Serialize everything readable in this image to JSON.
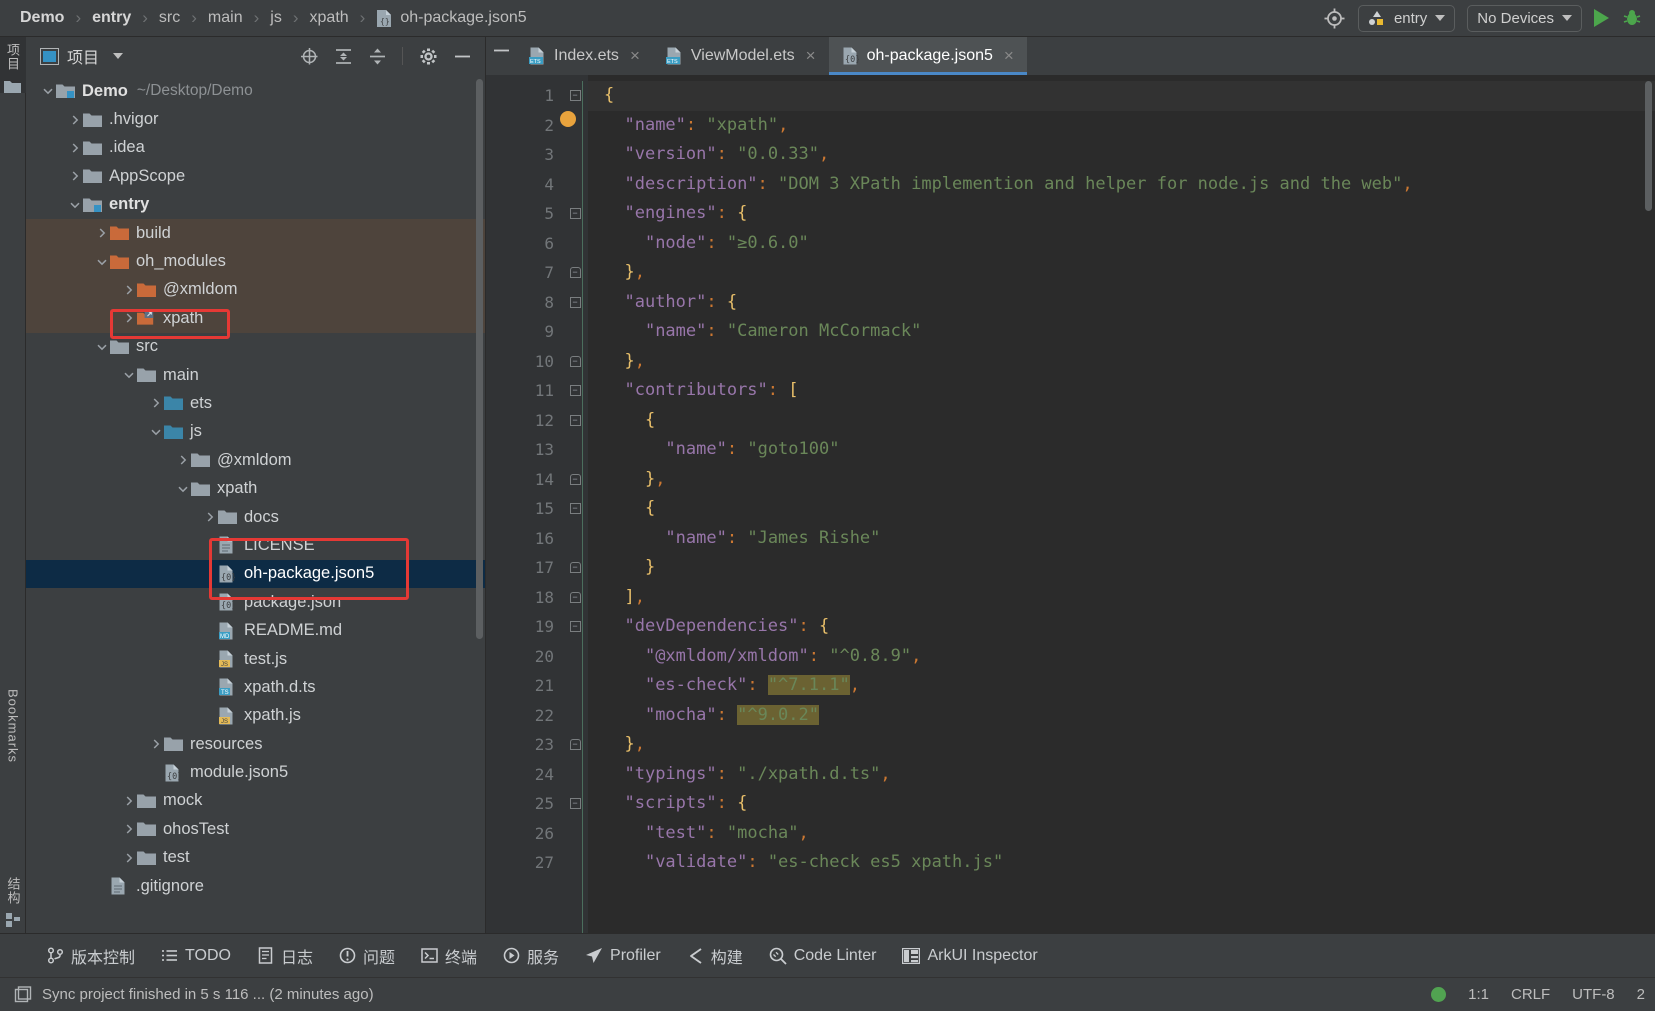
{
  "breadcrumb": {
    "items": [
      "Demo",
      "entry",
      "src",
      "main",
      "js",
      "xpath"
    ],
    "file": "oh-package.json5",
    "separator": "›"
  },
  "toolbar": {
    "target_icon": "target-icon",
    "run_config_label": "entry",
    "device_label": "No Devices",
    "run_label": "run-button",
    "debug_label": "debug-button"
  },
  "left_rail": {
    "project_label": "项目",
    "bookmarks_label": "Bookmarks",
    "structure_label": "结构"
  },
  "project_panel": {
    "title": "项目",
    "icons": [
      "project-view-chevron",
      "locate-icon",
      "expand-all-icon",
      "collapse-all-icon",
      "settings-icon",
      "hide-icon"
    ],
    "tree": [
      {
        "depth": 0,
        "label": "Demo",
        "sub": "~/Desktop/Demo",
        "arrow": "down",
        "icon": "folder-module",
        "bold": true,
        "state": "normal"
      },
      {
        "depth": 1,
        "label": ".hvigor",
        "sub": "",
        "arrow": "right",
        "icon": "folder-gray",
        "bold": false,
        "state": "normal"
      },
      {
        "depth": 1,
        "label": ".idea",
        "sub": "",
        "arrow": "right",
        "icon": "folder-gray",
        "bold": false,
        "state": "normal"
      },
      {
        "depth": 1,
        "label": "AppScope",
        "sub": "",
        "arrow": "right",
        "icon": "folder-gray",
        "bold": false,
        "state": "normal"
      },
      {
        "depth": 1,
        "label": "entry",
        "sub": "",
        "arrow": "down",
        "icon": "folder-module",
        "bold": true,
        "state": "normal"
      },
      {
        "depth": 2,
        "label": "build",
        "sub": "",
        "arrow": "right",
        "icon": "folder-orange",
        "bold": false,
        "state": "excluded"
      },
      {
        "depth": 2,
        "label": "oh_modules",
        "sub": "",
        "arrow": "down",
        "icon": "folder-orange",
        "bold": false,
        "state": "excluded"
      },
      {
        "depth": 3,
        "label": "@xmldom",
        "sub": "",
        "arrow": "right",
        "icon": "folder-orange",
        "bold": false,
        "state": "excluded"
      },
      {
        "depth": 3,
        "label": "xpath",
        "sub": "",
        "arrow": "right",
        "icon": "folder-orange-link",
        "bold": false,
        "state": "excluded",
        "annotate": "red-box"
      },
      {
        "depth": 2,
        "label": "src",
        "sub": "",
        "arrow": "down",
        "icon": "folder-gray",
        "bold": false,
        "state": "normal"
      },
      {
        "depth": 3,
        "label": "main",
        "sub": "",
        "arrow": "down",
        "icon": "folder-gray",
        "bold": false,
        "state": "normal"
      },
      {
        "depth": 4,
        "label": "ets",
        "sub": "",
        "arrow": "right",
        "icon": "folder-blue",
        "bold": false,
        "state": "normal"
      },
      {
        "depth": 4,
        "label": "js",
        "sub": "",
        "arrow": "down",
        "icon": "folder-blue",
        "bold": false,
        "state": "normal"
      },
      {
        "depth": 5,
        "label": "@xmldom",
        "sub": "",
        "arrow": "right",
        "icon": "folder-gray",
        "bold": false,
        "state": "normal"
      },
      {
        "depth": 5,
        "label": "xpath",
        "sub": "",
        "arrow": "down",
        "icon": "folder-gray",
        "bold": false,
        "state": "normal"
      },
      {
        "depth": 6,
        "label": "docs",
        "sub": "",
        "arrow": "right",
        "icon": "folder-gray",
        "bold": false,
        "state": "normal"
      },
      {
        "depth": 6,
        "label": "LICENSE",
        "sub": "",
        "arrow": "none",
        "icon": "file-plain",
        "bold": false,
        "state": "normal"
      },
      {
        "depth": 6,
        "label": "oh-package.json5",
        "sub": "",
        "arrow": "none",
        "icon": "file-json5",
        "bold": false,
        "state": "selected",
        "annotate": "red-box"
      },
      {
        "depth": 6,
        "label": "package.json",
        "sub": "",
        "arrow": "none",
        "icon": "file-json5",
        "bold": false,
        "state": "normal",
        "annotate": "red-box"
      },
      {
        "depth": 6,
        "label": "README.md",
        "sub": "",
        "arrow": "none",
        "icon": "file-md",
        "bold": false,
        "state": "normal"
      },
      {
        "depth": 6,
        "label": "test.js",
        "sub": "",
        "arrow": "none",
        "icon": "file-js",
        "bold": false,
        "state": "normal"
      },
      {
        "depth": 6,
        "label": "xpath.d.ts",
        "sub": "",
        "arrow": "none",
        "icon": "file-ts",
        "bold": false,
        "state": "normal"
      },
      {
        "depth": 6,
        "label": "xpath.js",
        "sub": "",
        "arrow": "none",
        "icon": "file-js",
        "bold": false,
        "state": "normal"
      },
      {
        "depth": 4,
        "label": "resources",
        "sub": "",
        "arrow": "right",
        "icon": "folder-gray",
        "bold": false,
        "state": "normal"
      },
      {
        "depth": 4,
        "label": "module.json5",
        "sub": "",
        "arrow": "none",
        "icon": "file-json5",
        "bold": false,
        "state": "normal"
      },
      {
        "depth": 3,
        "label": "mock",
        "sub": "",
        "arrow": "right",
        "icon": "folder-gray",
        "bold": false,
        "state": "normal"
      },
      {
        "depth": 3,
        "label": "ohosTest",
        "sub": "",
        "arrow": "right",
        "icon": "folder-gray",
        "bold": false,
        "state": "normal"
      },
      {
        "depth": 3,
        "label": "test",
        "sub": "",
        "arrow": "right",
        "icon": "folder-gray",
        "bold": false,
        "state": "normal"
      },
      {
        "depth": 2,
        "label": ".gitignore",
        "sub": "",
        "arrow": "none",
        "icon": "file-plain",
        "bold": false,
        "state": "normal"
      }
    ]
  },
  "editor": {
    "tabs": [
      {
        "label": "Index.ets",
        "icon": "file-ets",
        "active": false,
        "closable": true
      },
      {
        "label": "ViewModel.ets",
        "icon": "file-ets",
        "active": false,
        "closable": true
      },
      {
        "label": "oh-package.json5",
        "icon": "file-json5",
        "active": true,
        "closable": true
      }
    ],
    "lines": [
      {
        "n": 1,
        "fold": "minus",
        "text": "{"
      },
      {
        "n": 2,
        "fold": "none",
        "text": "  \"name\": \"xpath\","
      },
      {
        "n": 3,
        "fold": "none",
        "text": "  \"version\": \"0.0.33\","
      },
      {
        "n": 4,
        "fold": "none",
        "text": "  \"description\": \"DOM 3 XPath implemention and helper for node.js and the web\","
      },
      {
        "n": 5,
        "fold": "minus",
        "text": "  \"engines\": {"
      },
      {
        "n": 6,
        "fold": "none",
        "text": "    \"node\": \"≥0.6.0\""
      },
      {
        "n": 7,
        "fold": "end",
        "text": "  },"
      },
      {
        "n": 8,
        "fold": "minus",
        "text": "  \"author\": {"
      },
      {
        "n": 9,
        "fold": "none",
        "text": "    \"name\": \"Cameron McCormack\""
      },
      {
        "n": 10,
        "fold": "end",
        "text": "  },"
      },
      {
        "n": 11,
        "fold": "minus",
        "text": "  \"contributors\": ["
      },
      {
        "n": 12,
        "fold": "minus",
        "text": "    {"
      },
      {
        "n": 13,
        "fold": "none",
        "text": "      \"name\": \"goto100\""
      },
      {
        "n": 14,
        "fold": "end",
        "text": "    },"
      },
      {
        "n": 15,
        "fold": "minus",
        "text": "    {"
      },
      {
        "n": 16,
        "fold": "none",
        "text": "      \"name\": \"James Rishe\""
      },
      {
        "n": 17,
        "fold": "end",
        "text": "    }"
      },
      {
        "n": 18,
        "fold": "end",
        "text": "  ],"
      },
      {
        "n": 19,
        "fold": "minus",
        "text": "  \"devDependencies\": {"
      },
      {
        "n": 20,
        "fold": "none",
        "text": "    \"@xmldom/xmldom\": \"^0.8.9\","
      },
      {
        "n": 21,
        "fold": "none",
        "text": "    \"es-check\": \"^7.1.1\","
      },
      {
        "n": 22,
        "fold": "none",
        "text": "    \"mocha\": \"^9.0.2\""
      },
      {
        "n": 23,
        "fold": "end",
        "text": "  },"
      },
      {
        "n": 24,
        "fold": "none",
        "text": "  \"typings\": \"./xpath.d.ts\","
      },
      {
        "n": 25,
        "fold": "minus",
        "text": "  \"scripts\": {"
      },
      {
        "n": 26,
        "fold": "none",
        "text": "    \"test\": \"mocha\","
      },
      {
        "n": 27,
        "fold": "none",
        "text": "    \"validate\": \"es-check es5 xpath.js\""
      }
    ]
  },
  "tool_window_bar": {
    "buttons": [
      {
        "label": "版本控制",
        "icon": "vcs-icon"
      },
      {
        "label": "TODO",
        "icon": "todo-icon"
      },
      {
        "label": "日志",
        "icon": "log-icon"
      },
      {
        "label": "问题",
        "icon": "problems-icon"
      },
      {
        "label": "终端",
        "icon": "terminal-icon"
      },
      {
        "label": "服务",
        "icon": "services-icon"
      },
      {
        "label": "Profiler",
        "icon": "profiler-icon"
      },
      {
        "label": "构建",
        "icon": "build-icon"
      },
      {
        "label": "Code Linter",
        "icon": "code-linter-icon"
      },
      {
        "label": "ArkUI Inspector",
        "icon": "arkui-inspector-icon"
      }
    ]
  },
  "status_bar": {
    "message": "Sync project finished in 5 s 116 ... (2 minutes ago)",
    "caret": "1:1",
    "line_separator": "CRLF",
    "encoding": "UTF-8",
    "indent": "2"
  },
  "colors": {
    "accent_blue": "#4a88c7",
    "selection": "#0d2b45",
    "excluded_orange": "#4e443c",
    "annotation_red": "#e53935",
    "run_green": "#4ca64c",
    "string_green": "#6a8759",
    "key_purple": "#9876aa",
    "punct_orange": "#cc7832",
    "search_highlight": "#6b6232"
  }
}
